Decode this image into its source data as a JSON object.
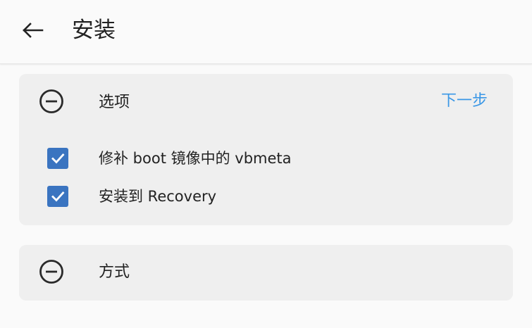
{
  "header": {
    "back_icon": "arrow-left-icon",
    "title": "安装"
  },
  "options_card": {
    "collapse_icon": "minus-circle-icon",
    "title": "选项",
    "next_label": "下一步",
    "items": [
      {
        "label": "修补 boot 镜像中的 vbmeta",
        "checked": true
      },
      {
        "label": "安装到 Recovery",
        "checked": true
      }
    ]
  },
  "method_card": {
    "collapse_icon": "minus-circle-icon",
    "title": "方式"
  },
  "colors": {
    "accent": "#3a97e6",
    "checkbox": "#3a74c0",
    "card_bg": "#efefef",
    "page_bg": "#fafafa"
  }
}
